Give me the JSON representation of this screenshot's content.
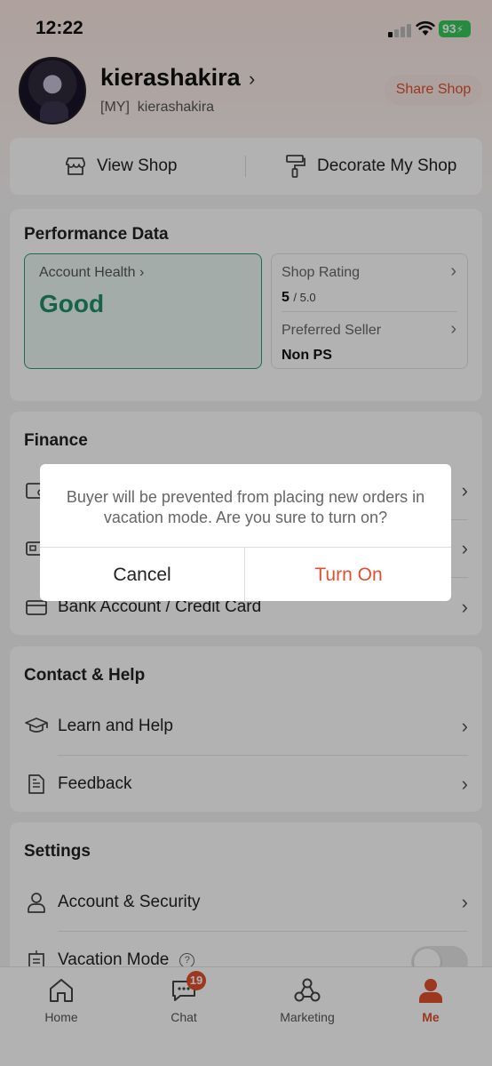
{
  "status_bar": {
    "time": "12:22",
    "battery": "93"
  },
  "profile": {
    "username": "kierashakira",
    "region": "[MY]",
    "handle": "kierashakira",
    "share_label": "Share Shop"
  },
  "shop_actions": {
    "view_shop": "View Shop",
    "decorate": "Decorate My Shop"
  },
  "performance": {
    "title": "Performance Data",
    "health_label": "Account Health",
    "health_value": "Good",
    "rating_label": "Shop Rating",
    "rating_value": "5",
    "rating_max": "/ 5.0",
    "preferred_label": "Preferred Seller",
    "preferred_value": "Non PS"
  },
  "finance": {
    "title": "Finance",
    "items": [
      {
        "label": ""
      },
      {
        "label": ""
      },
      {
        "label": "Bank Account / Credit Card"
      }
    ]
  },
  "contact": {
    "title": "Contact & Help",
    "items": [
      {
        "label": "Learn and Help"
      },
      {
        "label": "Feedback"
      }
    ]
  },
  "settings": {
    "title": "Settings",
    "items": [
      {
        "label": "Account & Security"
      },
      {
        "label": "Vacation Mode"
      }
    ],
    "vacation_help": "?"
  },
  "tabbar": {
    "tabs": [
      {
        "label": "Home"
      },
      {
        "label": "Chat",
        "badge": "19"
      },
      {
        "label": "Marketing"
      },
      {
        "label": "Me"
      }
    ]
  },
  "dialog": {
    "message": "Buyer will be prevented from placing new orders in vacation mode. Are you sure to turn on?",
    "cancel": "Cancel",
    "confirm": "Turn On"
  },
  "colors": {
    "accent": "#e0502e",
    "health_green": "#1f8e6a",
    "battery_green": "#35c759"
  }
}
